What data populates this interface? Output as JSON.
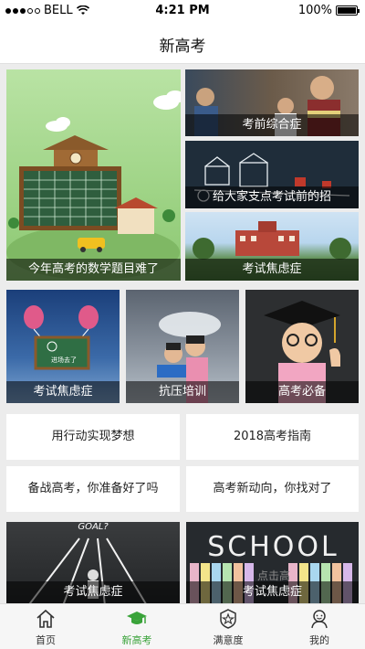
{
  "status_bar": {
    "carrier": "BELL",
    "time": "4:21 PM",
    "battery": "100%"
  },
  "header": {
    "title": "新高考"
  },
  "featured": {
    "main": {
      "caption": "今年高考的数学题目难了"
    },
    "side": [
      {
        "caption": "考前综合症"
      },
      {
        "caption": "给大家支点考试前的招"
      },
      {
        "caption": "考试焦虑症"
      }
    ]
  },
  "row_tiles": [
    {
      "caption": "考试焦虑症",
      "board_text": "进场去了"
    },
    {
      "caption": "抗压培训"
    },
    {
      "caption": "高考必备"
    }
  ],
  "text_links": [
    {
      "label": "用行动实现梦想"
    },
    {
      "label": "2018高考指南"
    },
    {
      "label": "备战高考，你准备好了吗"
    },
    {
      "label": "高考新动向，你找对了"
    }
  ],
  "bottom_tiles": [
    {
      "caption": "考试焦虑症",
      "art_text": "GOAL?"
    },
    {
      "caption": "考试焦虑症",
      "art_text": "SCHOOL",
      "art_subtext": "点击高"
    }
  ],
  "tab_bar": [
    {
      "label": "首页",
      "icon": "home-icon"
    },
    {
      "label": "新高考",
      "icon": "graduation-cap-icon",
      "active": true
    },
    {
      "label": "满意度",
      "icon": "star-badge-icon"
    },
    {
      "label": "我的",
      "icon": "user-icon"
    }
  ],
  "colors": {
    "accent": "#3aa33a",
    "caption_bg": "rgba(0,0,0,0.55)"
  }
}
